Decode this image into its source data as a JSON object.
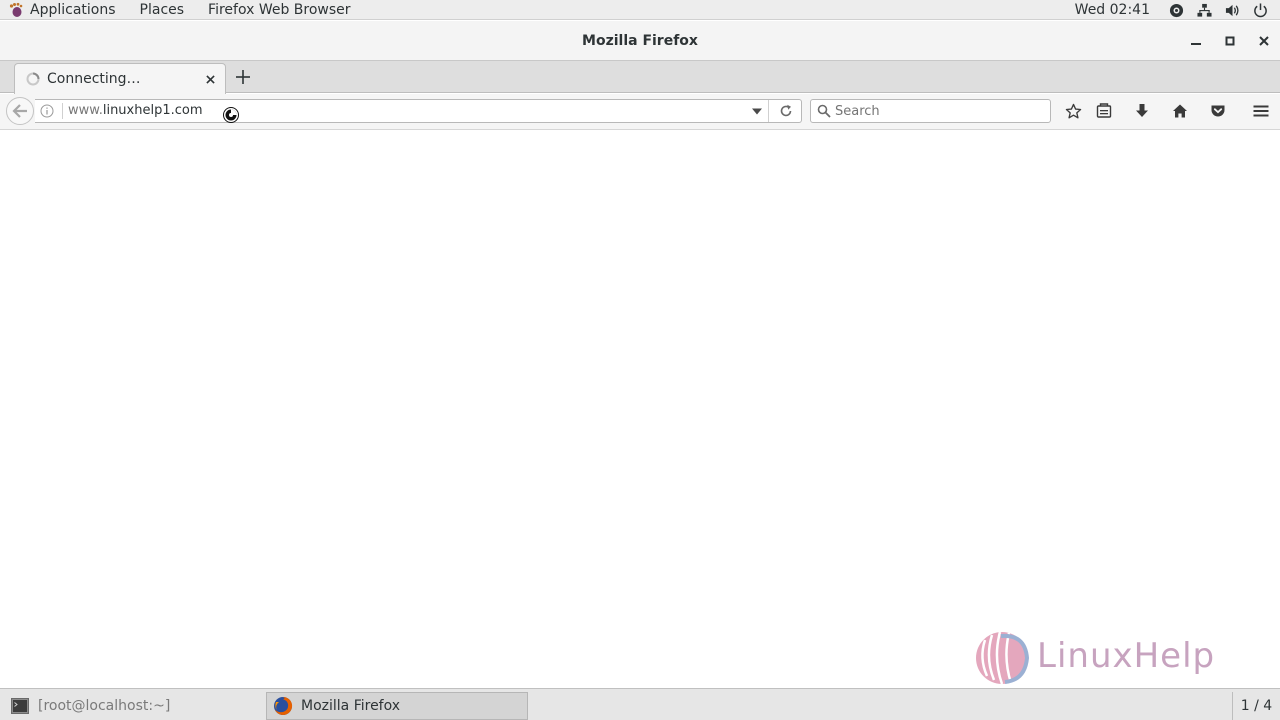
{
  "topbar": {
    "applications_label": "Applications",
    "places_label": "Places",
    "app_label": "Firefox Web Browser",
    "clock": "Wed 02:41",
    "tray_icons": [
      "accessibility-icon",
      "network-icon",
      "volume-icon",
      "power-icon"
    ]
  },
  "window": {
    "title": "Mozilla Firefox"
  },
  "tabs": [
    {
      "label": "Connecting…",
      "loading": true
    }
  ],
  "navbar": {
    "url_prefix": "www.",
    "url_domain": "linuxhelp1.com",
    "search_placeholder": "Search",
    "toolbar_icons": [
      "bookmark-star-icon",
      "reading-list-icon",
      "downloads-icon",
      "home-icon",
      "pocket-icon",
      "hamburger-menu-icon"
    ]
  },
  "watermark": {
    "text": "LinuxHelp"
  },
  "taskbar": {
    "items": [
      {
        "label": "[root@localhost:~]",
        "active": false
      },
      {
        "label": "Mozilla Firefox",
        "active": true
      }
    ],
    "workspace": "1 / 4"
  },
  "colors": {
    "topbar_bg": "#ededed",
    "chrome_bg": "#f5f5f5",
    "tabstrip_bg": "#dedede",
    "taskbar_bg": "#e6e6e6",
    "watermark": "#c7a3bf"
  }
}
